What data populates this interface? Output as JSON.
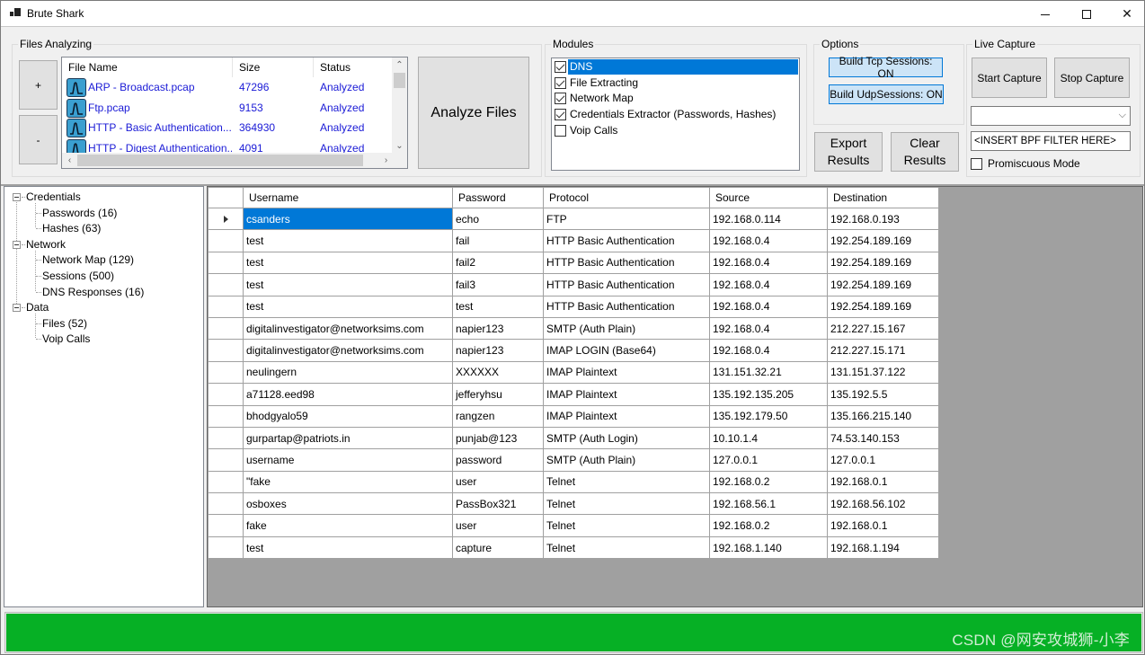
{
  "window": {
    "title": "Brute Shark",
    "controls": {
      "minimize": "minimize",
      "maximize": "maximize",
      "close": "✕"
    }
  },
  "files_analyzing": {
    "group_label": "Files Analyzing",
    "add_label": "+",
    "remove_label": "-",
    "columns": [
      "File Name",
      "Size",
      "Status"
    ],
    "files": [
      {
        "name": "ARP - Broadcast.pcap",
        "size": "47296",
        "status": "Analyzed",
        "icon": "pcap-file-icon"
      },
      {
        "name": "Ftp.pcap",
        "size": "9153",
        "status": "Analyzed",
        "icon": "pcap-file-icon"
      },
      {
        "name": "HTTP - Basic Authentication....",
        "size": "364930",
        "status": "Analyzed",
        "icon": "pcap-file-icon"
      },
      {
        "name": "HTTP - Digest Authentication...",
        "size": "4091",
        "status": "Analyzed",
        "icon": "pcap-file-icon"
      }
    ],
    "analyze_label": "Analyze Files"
  },
  "modules": {
    "group_label": "Modules",
    "items": [
      {
        "label": "DNS",
        "checked": true,
        "selected": true
      },
      {
        "label": "File Extracting",
        "checked": true,
        "selected": false
      },
      {
        "label": "Network Map",
        "checked": true,
        "selected": false
      },
      {
        "label": "Credentials Extractor (Passwords, Hashes)",
        "checked": true,
        "selected": false
      },
      {
        "label": "Voip Calls",
        "checked": false,
        "selected": false
      }
    ]
  },
  "options": {
    "group_label": "Options",
    "tcp_label": "Build Tcp Sessions: ON",
    "udp_label": "Build UdpSessions: ON",
    "export_label": "Export Results",
    "clear_label": "Clear Results"
  },
  "live_capture": {
    "group_label": "Live Capture",
    "start_label": "Start Capture",
    "stop_label": "Stop Capture",
    "interface_value": "",
    "bpf_filter_value": "<INSERT BPF FILTER HERE>",
    "promiscuous_label": "Promiscuous Mode",
    "promiscuous_checked": false
  },
  "tree": {
    "nodes": [
      {
        "label": "Credentials",
        "level": 0,
        "expanded": true
      },
      {
        "label": "Passwords (16)",
        "level": 1
      },
      {
        "label": "Hashes (63)",
        "level": 1
      },
      {
        "label": "Network",
        "level": 0,
        "expanded": true
      },
      {
        "label": "Network Map (129)",
        "level": 1
      },
      {
        "label": "Sessions (500)",
        "level": 1
      },
      {
        "label": "DNS Responses (16)",
        "level": 1
      },
      {
        "label": "Data",
        "level": 0,
        "expanded": true
      },
      {
        "label": "Files (52)",
        "level": 1
      },
      {
        "label": "Voip Calls",
        "level": 1
      }
    ]
  },
  "grid": {
    "columns": [
      "Username",
      "Password",
      "Protocol",
      "Source",
      "Destination"
    ],
    "rows": [
      [
        "csanders",
        "echo",
        "FTP",
        "192.168.0.114",
        "192.168.0.193"
      ],
      [
        "test",
        "fail",
        "HTTP Basic Authentication",
        "192.168.0.4",
        "192.254.189.169"
      ],
      [
        "test",
        "fail2",
        "HTTP Basic Authentication",
        "192.168.0.4",
        "192.254.189.169"
      ],
      [
        "test",
        "fail3",
        "HTTP Basic Authentication",
        "192.168.0.4",
        "192.254.189.169"
      ],
      [
        "test",
        "test",
        "HTTP Basic Authentication",
        "192.168.0.4",
        "192.254.189.169"
      ],
      [
        "digitalinvestigator@networksims.com",
        "napier123",
        "SMTP (Auth Plain)",
        "192.168.0.4",
        "212.227.15.167"
      ],
      [
        "digitalinvestigator@networksims.com",
        "napier123",
        "IMAP LOGIN (Base64)",
        "192.168.0.4",
        "212.227.15.171"
      ],
      [
        "neulingern",
        "XXXXXX",
        "IMAP Plaintext",
        "131.151.32.21",
        "131.151.37.122"
      ],
      [
        "a71128.eed98",
        "jefferyhsu",
        "IMAP Plaintext",
        "135.192.135.205",
        "135.192.5.5"
      ],
      [
        "bhodgyalo59",
        "rangzen",
        "IMAP Plaintext",
        "135.192.179.50",
        "135.166.215.140"
      ],
      [
        "gurpartap@patriots.in",
        "punjab@123",
        "SMTP (Auth Login)",
        "10.10.1.4",
        "74.53.140.153"
      ],
      [
        "username",
        "password",
        "SMTP (Auth Plain)",
        "127.0.0.1",
        "127.0.0.1"
      ],
      [
        "\"fake",
        "user",
        "Telnet",
        "192.168.0.2",
        "192.168.0.1"
      ],
      [
        "osboxes",
        "PassBox321",
        "Telnet",
        "192.168.56.1",
        "192.168.56.102"
      ],
      [
        "fake",
        "user",
        "Telnet",
        "192.168.0.2",
        "192.168.0.1"
      ],
      [
        "test",
        "capture",
        "Telnet",
        "192.168.1.140",
        "192.168.1.194"
      ]
    ],
    "selected_row": 0
  },
  "progress": {
    "value_percent": 100,
    "color": "#06b025"
  },
  "watermark": "CSDN @网安攻城狮-小李",
  "colors": {
    "selection": "#0078d7",
    "file_text": "#1a1ad6",
    "toggle_bg": "#cce4f7"
  }
}
